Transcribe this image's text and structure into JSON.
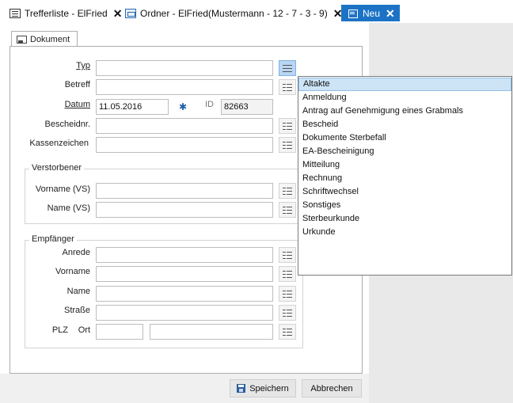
{
  "tabs": [
    {
      "label": "Trefferliste - ElFried",
      "icon": "list-icon"
    },
    {
      "label": "Ordner - ElFried(Mustermann - 12 - 7 - 3 - 9)",
      "icon": "folder-icon"
    },
    {
      "label": "Neu",
      "icon": "new-document-icon",
      "active": true
    }
  ],
  "document_tab": {
    "label": "Dokument"
  },
  "form": {
    "typ_label": "Typ",
    "typ_value": "",
    "betreff_label": "Betreff",
    "betreff_value": "",
    "datum_label": "Datum",
    "datum_value": "11.05.2016",
    "id_label": "ID",
    "id_value": "82663",
    "bescheidnr_label": "Bescheidnr.",
    "bescheidnr_value": "",
    "kassenzeichen_label": "Kassenzeichen",
    "kassenzeichen_value": ""
  },
  "verstorbener": {
    "title": "Verstorbener",
    "vorname_label": "Vorname (VS)",
    "vorname_value": "",
    "name_label": "Name (VS)",
    "name_value": ""
  },
  "empfaenger": {
    "title": "Empfänger",
    "anrede_label": "Anrede",
    "vorname_label": "Vorname",
    "name_label": "Name",
    "strasse_label": "Straße",
    "plz_label": "PLZ",
    "ort_label": "Ort"
  },
  "buttons": {
    "save": "Speichern",
    "cancel": "Abbrechen"
  },
  "dropdown": {
    "items": [
      "Altakte",
      "Anmeldung",
      "Antrag auf Genehmigung eines Grabmals",
      "Bescheid",
      "Dokumente Sterbefall",
      "EA-Bescheinigung",
      "Mitteilung",
      "Rechnung",
      "Schriftwechsel",
      "Sonstiges",
      "Sterbeurkunde",
      "Urkunde"
    ],
    "selected": "Altakte"
  },
  "colors": {
    "accent": "#1c73c6",
    "selection": "#cde4f7"
  }
}
